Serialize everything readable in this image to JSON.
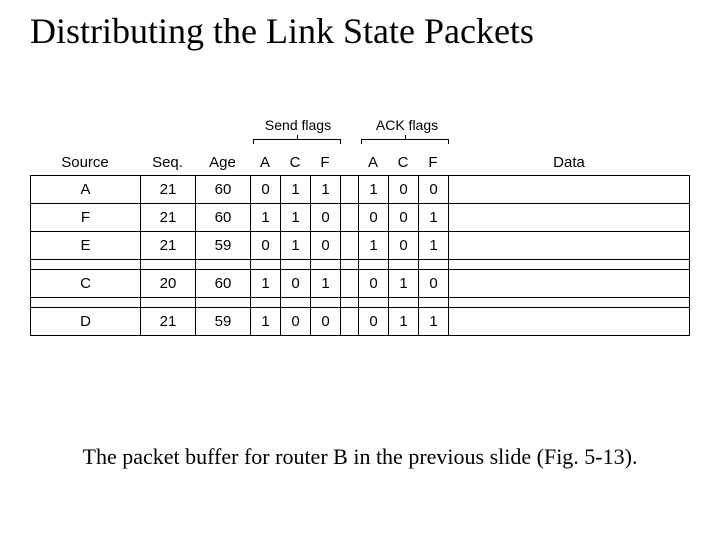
{
  "title": "Distributing the Link State Packets",
  "caption": "The packet buffer for router B in the previous slide (Fig.  5-13).",
  "headers": {
    "source": "Source",
    "seq": "Seq.",
    "age": "Age",
    "send_group": "Send flags",
    "ack_group": "ACK flags",
    "a": "A",
    "c": "C",
    "f": "F",
    "data": "Data"
  },
  "rows": [
    {
      "source": "A",
      "seq": "21",
      "age": "60",
      "send": [
        "0",
        "1",
        "1"
      ],
      "ack": [
        "1",
        "0",
        "0"
      ]
    },
    {
      "source": "F",
      "seq": "21",
      "age": "60",
      "send": [
        "1",
        "1",
        "0"
      ],
      "ack": [
        "0",
        "0",
        "1"
      ]
    },
    {
      "source": "E",
      "seq": "21",
      "age": "59",
      "send": [
        "0",
        "1",
        "0"
      ],
      "ack": [
        "1",
        "0",
        "1"
      ]
    },
    {
      "source": "C",
      "seq": "20",
      "age": "60",
      "send": [
        "1",
        "0",
        "1"
      ],
      "ack": [
        "0",
        "1",
        "0"
      ]
    },
    {
      "source": "D",
      "seq": "21",
      "age": "59",
      "send": [
        "1",
        "0",
        "0"
      ],
      "ack": [
        "0",
        "1",
        "1"
      ]
    }
  ]
}
